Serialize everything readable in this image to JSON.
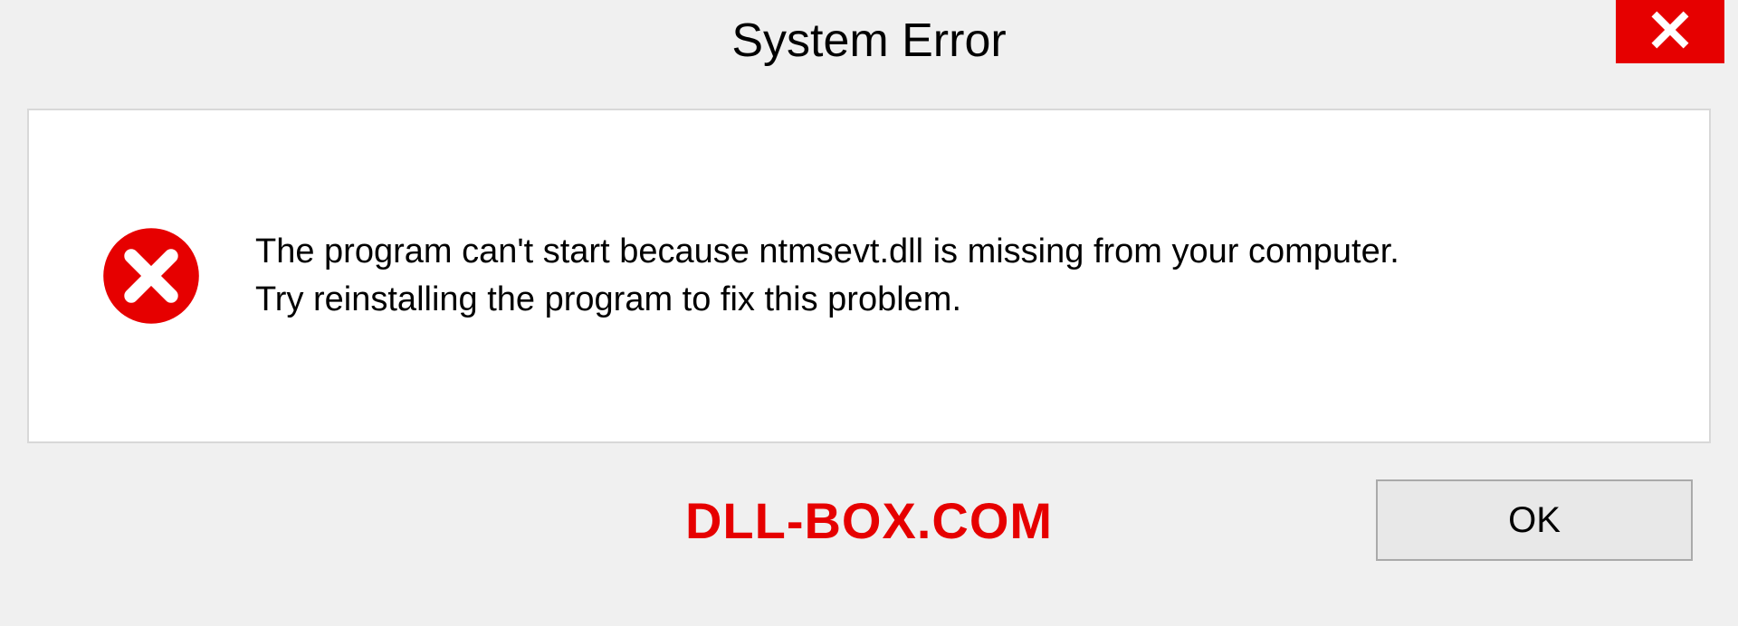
{
  "titlebar": {
    "title": "System Error"
  },
  "content": {
    "message": "The program can't start because ntmsevt.dll is missing from your computer.\nTry reinstalling the program to fix this problem."
  },
  "footer": {
    "watermark": "DLL-BOX.COM",
    "ok_label": "OK"
  },
  "colors": {
    "error_red": "#e60000",
    "background": "#f0f0f0",
    "content_bg": "#ffffff"
  }
}
